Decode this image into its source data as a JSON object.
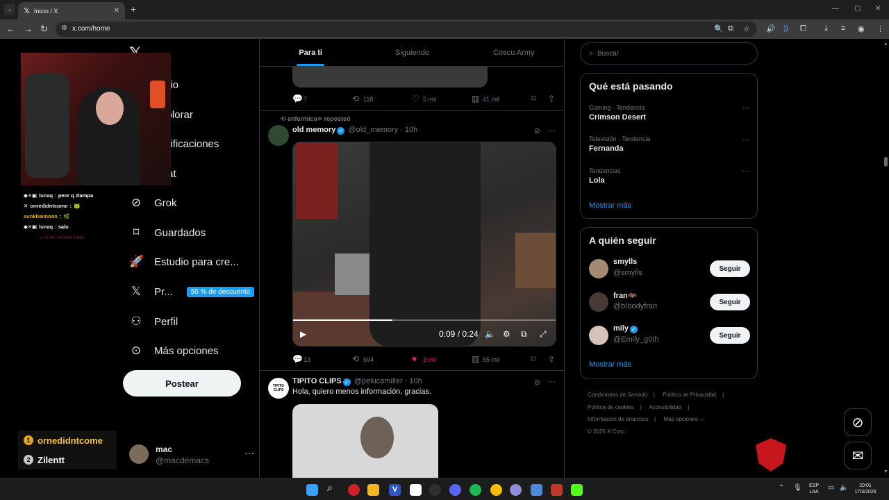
{
  "browser": {
    "tab_title": "Inicio / X",
    "url": "x.com/home"
  },
  "nav": {
    "items": [
      {
        "label": "Inicio",
        "icon": "home-icon"
      },
      {
        "label": "Explorar",
        "icon": "search-icon"
      },
      {
        "label": "Notificaciones",
        "icon": "bell-icon"
      },
      {
        "label": "Chat",
        "icon": "mail-icon"
      },
      {
        "label": "Grok",
        "icon": "grok-icon"
      },
      {
        "label": "Guardados",
        "icon": "bookmark-icon"
      },
      {
        "label": "Estudio para cre...",
        "icon": "rocket-icon"
      },
      {
        "label": "Pr...",
        "icon": "x-logo-icon",
        "badge": "50 % de descuento"
      },
      {
        "label": "Perfil",
        "icon": "user-icon"
      },
      {
        "label": "Más opciones",
        "icon": "more-circle-icon"
      }
    ],
    "post_button": "Postear",
    "account": {
      "name": "mac",
      "handle": "@macdemacs"
    }
  },
  "overlay": {
    "chat": [
      {
        "user": "lunaq",
        "msg": ": peor q zlampa"
      },
      {
        "user": "ornedidntcome",
        "msg": ":"
      },
      {
        "user": "sunkhaimoon",
        "msg": ":"
      },
      {
        "user": "lunaq",
        "msg": ": salu"
      },
      {
        "user": "",
        "msg": ": y si es verdad luna"
      }
    ],
    "ranking": [
      {
        "pos": "1",
        "name": "ornedidntcome"
      },
      {
        "pos": "2",
        "name": "Zilentt"
      }
    ]
  },
  "timeline": {
    "tabs": [
      "Para ti",
      "Siguiendo",
      "Coscu Army"
    ],
    "prev_tweet_stats": {
      "replies": "7",
      "reposts": "118",
      "likes": "5 mil",
      "views": "41 mil"
    },
    "tweet1": {
      "reposted_by": "enfermica✵ reposteó",
      "name": "old memory",
      "handle": "@old_memory",
      "time": "· 10h",
      "video_time": "0:09 / 0:24",
      "progress": 0.375,
      "stats": {
        "replies": "13",
        "reposts": "694",
        "likes": "3 mil",
        "views": "55 mil"
      }
    },
    "tweet2": {
      "name": "TIPITO CLIPS",
      "handle": "@pelucamiller",
      "time": "· 10h",
      "text": "Hola, quiero menos información, gracias.",
      "avatar_text": "TIPITO CLIPS"
    }
  },
  "sidebar": {
    "search_placeholder": "Buscar",
    "trends_title": "Qué está pasando",
    "trends": [
      {
        "context": "Gaming · Tendencia",
        "title": "Crimson Desert"
      },
      {
        "context": "Televisión · Tendencia",
        "title": "Fernanda"
      },
      {
        "context": "Tendencias",
        "title": "Lola"
      }
    ],
    "show_more": "Mostrar más",
    "who_title": "A quién seguir",
    "who": [
      {
        "name": "smylls",
        "handle": "@smylls",
        "button": "Seguir"
      },
      {
        "name": "fran🦇",
        "handle": "@bIoodyfran",
        "button": "Seguir"
      },
      {
        "name": "mily",
        "handle": "@Emily_g0th",
        "button": "Seguir"
      }
    ],
    "footer": [
      "Condiciones de Servicio",
      "Política de Privacidad",
      "Política de cookies",
      "Accesibilidad",
      "Información de anuncios",
      "Más opciones ···",
      "© 2026 X Corp."
    ]
  },
  "taskbar": {
    "lang": "ESP",
    "lang2": "LAA",
    "time": "20:01",
    "date": "17/3/2026"
  }
}
